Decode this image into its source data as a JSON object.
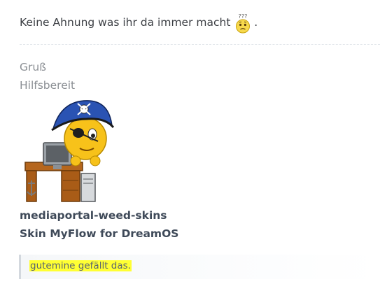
{
  "post": {
    "message": "Keine Ahnung was ihr da immer macht",
    "message_end": ".",
    "smiley_icon": "confused-smiley-icon",
    "smiley_label": "???"
  },
  "signature": {
    "greeting": "Gruß",
    "name": "Hilfsbereit",
    "image_icon": "pirate-smiley-at-computer",
    "bold_line_1": "mediaportal-weed-skins",
    "bold_line_2": "Skin MyFlow for DreamOS"
  },
  "likes": {
    "user": "gutemine",
    "suffix": " gefällt das."
  },
  "colors": {
    "highlight": "#ffff33",
    "text": "#3c3f44",
    "muted": "#8b8f94",
    "bold_text": "#3f4a59"
  }
}
